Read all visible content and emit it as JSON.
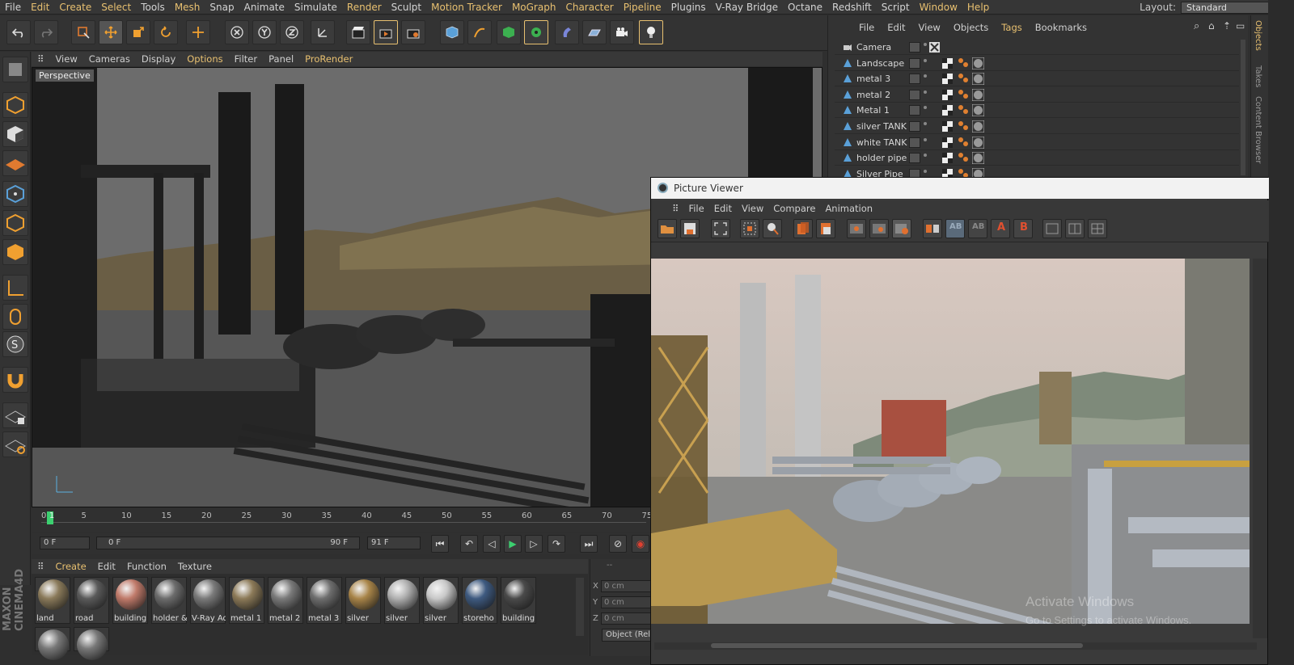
{
  "menu": [
    "File",
    "Edit",
    "Create",
    "Select",
    "Tools",
    "Mesh",
    "Snap",
    "Animate",
    "Simulate",
    "Render",
    "Sculpt",
    "Motion Tracker",
    "MoGraph",
    "Character",
    "Pipeline",
    "Plugins",
    "V-Ray Bridge",
    "Octane",
    "Redshift",
    "Script",
    "Window",
    "Help"
  ],
  "layout": {
    "label": "Layout:",
    "value": "Standard"
  },
  "viewport": {
    "menu": [
      "View",
      "Cameras",
      "Display",
      "Options",
      "Filter",
      "Panel",
      "ProRender"
    ],
    "label": "Perspective"
  },
  "timeline": {
    "ticks": [
      "0",
      "1",
      "5",
      "10",
      "15",
      "20",
      "25",
      "30",
      "35",
      "40",
      "45",
      "50",
      "55",
      "60",
      "65",
      "70",
      "75"
    ],
    "current": "0 F",
    "range_start": "0 F",
    "range_end": "90 F",
    "max": "91 F"
  },
  "material_manager": {
    "menu": [
      "Create",
      "Edit",
      "Function",
      "Texture"
    ],
    "materials": [
      {
        "label": "land",
        "color": "#8a7a5a"
      },
      {
        "label": "road",
        "color": "#5a5a5a"
      },
      {
        "label": "building",
        "color": "#c07a6a"
      },
      {
        "label": "holder &",
        "color": "#6c6c6c"
      },
      {
        "label": "V-Ray Ad",
        "color": "#7a7a7a"
      },
      {
        "label": "metal 1",
        "color": "#8c7a58"
      },
      {
        "label": "metal 2",
        "color": "#7a7a7a"
      },
      {
        "label": "metal 3",
        "color": "#6e6e6e"
      },
      {
        "label": "silver",
        "color": "#a88448"
      },
      {
        "label": "silver",
        "color": "#b0b0b0"
      },
      {
        "label": "silver",
        "color": "#c8c8c8"
      },
      {
        "label": "storeho",
        "color": "#3e5a80"
      },
      {
        "label": "building",
        "color": "#4a4a4a"
      }
    ]
  },
  "coords": {
    "header": "--",
    "rows": [
      {
        "axis": "X",
        "value": "0 cm"
      },
      {
        "axis": "Y",
        "value": "0 cm"
      },
      {
        "axis": "Z",
        "value": "0 cm"
      }
    ],
    "mode": "Object (Rel"
  },
  "object_manager": {
    "menu": [
      "File",
      "Edit",
      "View",
      "Objects",
      "Tags",
      "Bookmarks"
    ],
    "objects": [
      {
        "name": "Camera",
        "type": "camera"
      },
      {
        "name": "Landscape",
        "type": "mesh"
      },
      {
        "name": "metal 3",
        "type": "mesh"
      },
      {
        "name": "metal 2",
        "type": "mesh"
      },
      {
        "name": "Metal 1",
        "type": "mesh"
      },
      {
        "name": "silver TANK",
        "type": "mesh"
      },
      {
        "name": "white TANK",
        "type": "mesh"
      },
      {
        "name": "holder pipe",
        "type": "mesh"
      },
      {
        "name": "Silver Pipe",
        "type": "mesh"
      }
    ]
  },
  "side_tabs": [
    "Objects",
    "Takes",
    "Content Browser"
  ],
  "picture_viewer": {
    "title": "Picture Viewer",
    "menu": [
      "File",
      "Edit",
      "View",
      "Compare",
      "Animation"
    ],
    "ab_labels": {
      "a": "A",
      "b": "B",
      "ab": "AB"
    }
  },
  "watermark": {
    "line1": "Activate Windows",
    "line2": "Go to Settings to activate Windows."
  },
  "brand": "MAXON CINEMA4D",
  "colors": {
    "accent": "#e8c070",
    "panel": "#333333",
    "viewport_bg": "#6f6f6f"
  }
}
